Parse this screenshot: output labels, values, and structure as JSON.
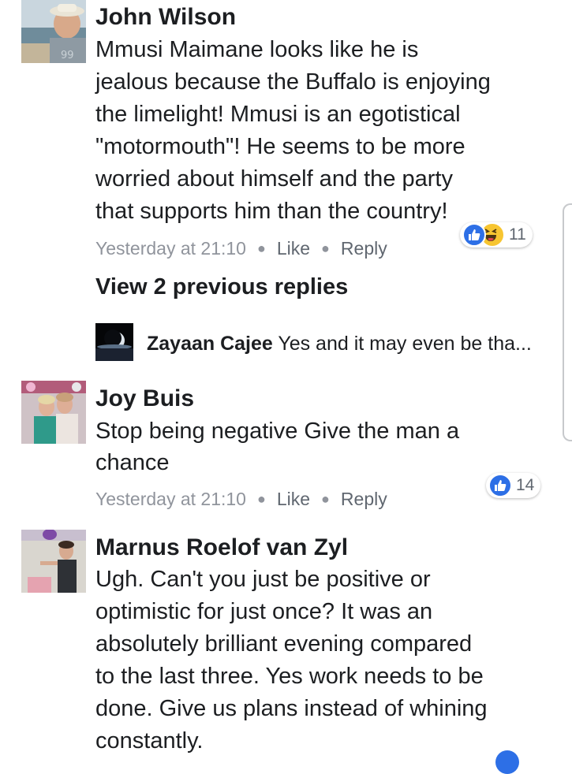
{
  "comments": [
    {
      "name": "John Wilson",
      "lines": [
        "Mmusi Maimane looks like he is",
        "jealous because the Buffalo is enjoying",
        "the limelight!  Mmusi is an egotistical",
        "\"motormouth\"!  He seems to be more",
        "worried about himself and the party",
        "that supports him than the country!"
      ],
      "time": "Yesterday at 21:10",
      "like": "Like",
      "reply": "Reply",
      "reactions_count": "11",
      "reaction_icons": [
        "like-icon",
        "haha-icon"
      ]
    },
    {
      "name": "Joy Buis",
      "lines": [
        "Stop being negative Give the man a",
        "chance"
      ],
      "time": "Yesterday at 21:10",
      "like": "Like",
      "reply": "Reply",
      "reactions_count": "14",
      "reaction_icons": [
        "like-icon"
      ]
    },
    {
      "name": "Marnus Roelof van Zyl",
      "lines": [
        "Ugh. Can't you just be positive or",
        "optimistic for just once? It was an",
        "absolutely brilliant evening compared",
        "to the last three. Yes work needs to be",
        "done. Give us plans instead of whining",
        "constantly."
      ]
    }
  ],
  "view_previous": "View 2 previous replies",
  "reply_preview": {
    "name": "Zayaan Cajee",
    "text": "Yes and it may even be tha..."
  },
  "colors": {
    "like_blue": "#2d6fe6",
    "haha_yellow": "#f7c531",
    "meta_gray": "#90949c"
  }
}
